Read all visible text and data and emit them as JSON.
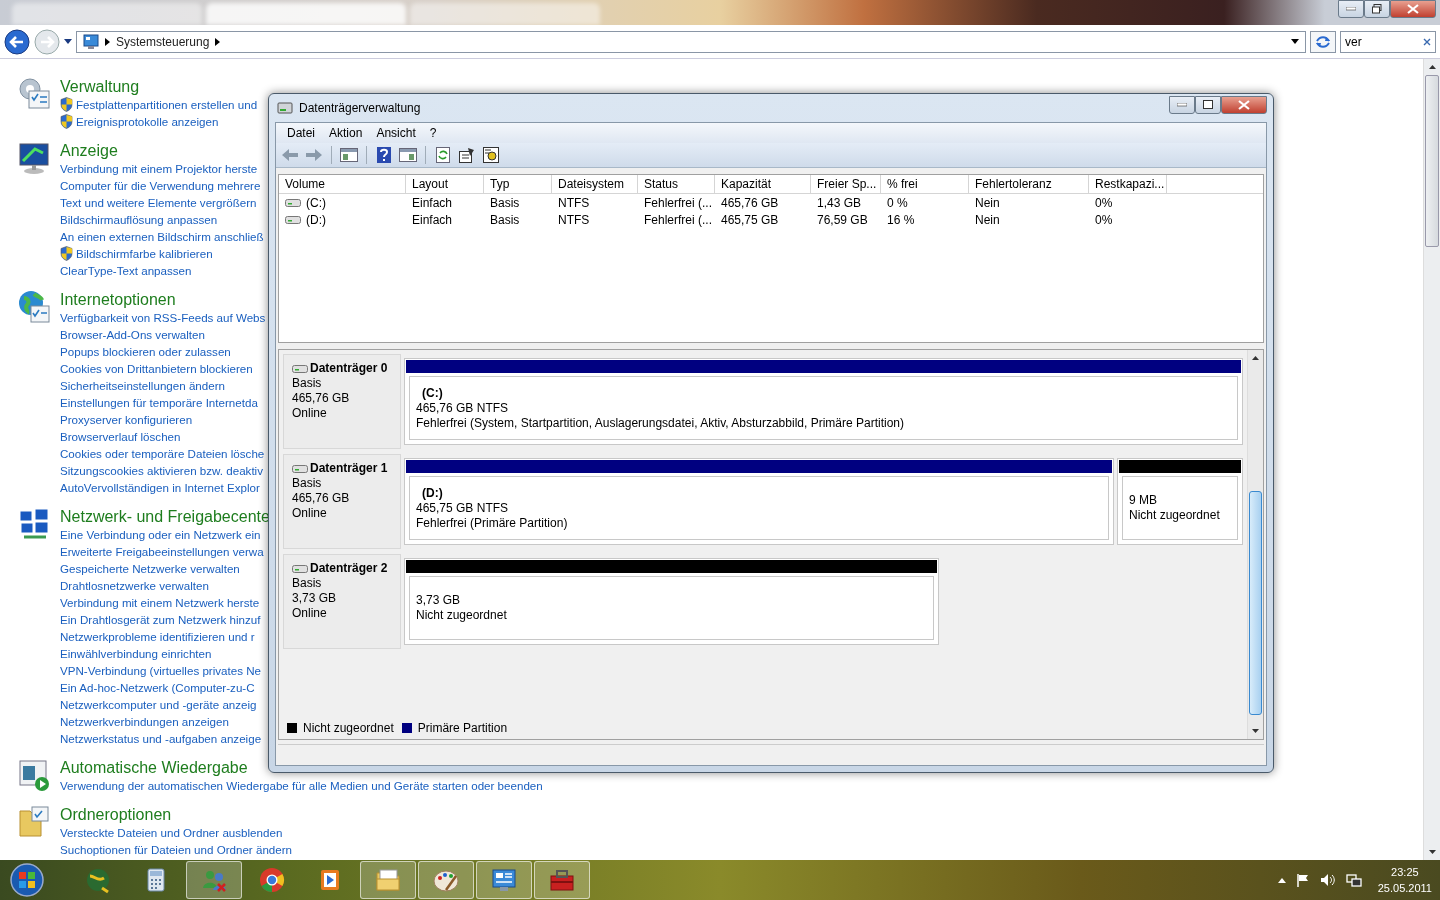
{
  "explorer": {
    "breadcrumb": [
      "Systemsteuerung"
    ],
    "search": {
      "value": "ver"
    }
  },
  "categories": [
    {
      "kind": "admin",
      "title": "Verwaltung",
      "links": [
        {
          "text": "Festplattenpartitionen erstellen und",
          "shield": true
        },
        {
          "text": "Ereignisprotokolle anzeigen",
          "shield": true
        }
      ]
    },
    {
      "kind": "display",
      "title": "Anzeige",
      "links": [
        {
          "text": "Verbindung mit einem Projektor herste",
          "shield": false
        },
        {
          "text": "Computer für die Verwendung mehrere",
          "shield": false
        },
        {
          "text": "Text und weitere Elemente vergrößern",
          "shield": false
        },
        {
          "text": "Bildschirmauflösung anpassen",
          "shield": false
        },
        {
          "text": "An einen externen Bildschirm anschließ",
          "shield": false
        },
        {
          "text": "Bildschirmfarbe kalibrieren",
          "shield": true
        },
        {
          "text": "ClearType-Text anpassen",
          "shield": false
        }
      ]
    },
    {
      "kind": "internet",
      "title": "Internetoptionen",
      "links": [
        {
          "text": "Verfügbarkeit von RSS-Feeds auf Webs",
          "shield": false
        },
        {
          "text": "Browser-Add-Ons verwalten",
          "shield": false
        },
        {
          "text": "Popups blockieren oder zulassen",
          "shield": false
        },
        {
          "text": "Cookies von Drittanbietern blockieren",
          "shield": false
        },
        {
          "text": "Sicherheitseinstellungen ändern",
          "shield": false
        },
        {
          "text": "Einstellungen für temporäre Internetda",
          "shield": false
        },
        {
          "text": "Proxyserver konfigurieren",
          "shield": false
        },
        {
          "text": "Browserverlauf löschen",
          "shield": false
        },
        {
          "text": "Cookies oder temporäre Dateien lösche",
          "shield": false
        },
        {
          "text": "Sitzungscookies aktivieren bzw. deaktiv",
          "shield": false
        },
        {
          "text": "AutoVervollständigen in Internet Explor",
          "shield": false
        }
      ]
    },
    {
      "kind": "network",
      "title": "Netzwerk- und Freigabecente",
      "links": [
        {
          "text": "Eine Verbindung oder ein Netzwerk ein",
          "shield": false
        },
        {
          "text": "Erweiterte Freigabeeinstellungen verwa",
          "shield": false
        },
        {
          "text": "Gespeicherte Netzwerke verwalten",
          "shield": false
        },
        {
          "text": "Drahtlosnetzwerke verwalten",
          "shield": false
        },
        {
          "text": "Verbindung mit einem Netzwerk herste",
          "shield": false
        },
        {
          "text": "Ein Drahtlosgerät zum Netzwerk hinzuf",
          "shield": false
        },
        {
          "text": "Netzwerkprobleme identifizieren und r",
          "shield": false
        },
        {
          "text": "Einwählverbindung einrichten",
          "shield": false
        },
        {
          "text": "VPN-Verbindung (virtuelles privates Ne",
          "shield": false
        },
        {
          "text": "Ein Ad-hoc-Netzwerk (Computer-zu-C",
          "shield": false
        },
        {
          "text": "Netzwerkcomputer und -geräte anzeig",
          "shield": false
        },
        {
          "text": "Netzwerkverbindungen anzeigen",
          "shield": false
        },
        {
          "text": "Netzwerkstatus und -aufgaben anzeige",
          "shield": false
        }
      ]
    },
    {
      "kind": "autoplay",
      "title": "Automatische Wiedergabe",
      "links": [
        {
          "text": "Verwendung der automatischen Wiedergabe für alle Medien und Geräte starten oder beenden",
          "shield": false
        }
      ]
    },
    {
      "kind": "folder",
      "title": "Ordneroptionen",
      "links": [
        {
          "text": "Versteckte Dateien und Ordner ausblenden",
          "shield": false
        },
        {
          "text": "Suchoptionen für Dateien und Ordner ändern",
          "shield": false
        }
      ]
    }
  ],
  "dialog": {
    "title": "Datenträgerverwaltung",
    "menu": [
      "Datei",
      "Aktion",
      "Ansicht",
      "?"
    ],
    "table": {
      "columns": [
        "Volume",
        "Layout",
        "Typ",
        "Dateisystem",
        "Status",
        "Kapazität",
        "Freier Sp...",
        "% frei",
        "Fehlertoleranz",
        "Restkapazi..."
      ],
      "rows": [
        [
          "(C:)",
          "Einfach",
          "Basis",
          "NTFS",
          "Fehlerfrei (...",
          "465,76 GB",
          "1,43 GB",
          "0 %",
          "Nein",
          "0%"
        ],
        [
          "(D:)",
          "Einfach",
          "Basis",
          "NTFS",
          "Fehlerfrei (...",
          "465,75 GB",
          "76,59 GB",
          "16 %",
          "Nein",
          "0%"
        ]
      ]
    },
    "disks": [
      {
        "name": "Datenträger 0",
        "type": "Basis",
        "size": "465,76 GB",
        "state": "Online",
        "partitions": [
          {
            "kind": "primary",
            "name": "(C:)",
            "size": "465,76 GB NTFS",
            "status": "Fehlerfrei (System, Startpartition, Auslagerungsdatei, Aktiv, Absturzabbild, Primäre Partition)"
          }
        ]
      },
      {
        "name": "Datenträger 1",
        "type": "Basis",
        "size": "465,76 GB",
        "state": "Online",
        "partitions": [
          {
            "kind": "primary",
            "name": "(D:)",
            "size": "465,75 GB NTFS",
            "status": "Fehlerfrei (Primäre Partition)"
          },
          {
            "kind": "unallocated",
            "size": "9 MB",
            "status": "Nicht zugeordnet"
          }
        ]
      },
      {
        "name": "Datenträger 2",
        "type": "Basis",
        "size": "3,73 GB",
        "state": "Online",
        "partitions": [
          {
            "kind": "unallocated",
            "size": "3,73 GB",
            "status": "Nicht zugeordnet"
          }
        ]
      }
    ],
    "legend": [
      {
        "kind": "unallocated",
        "label": "Nicht zugeordnet",
        "color": "#000000"
      },
      {
        "kind": "primary",
        "label": "Primäre Partition",
        "color": "#000080"
      }
    ]
  },
  "taskbar": {
    "apps": [
      {
        "kind": "globe",
        "running": false
      },
      {
        "kind": "calculator",
        "running": false
      },
      {
        "kind": "people",
        "running": true
      },
      {
        "kind": "chrome",
        "running": false
      },
      {
        "kind": "media",
        "running": false
      },
      {
        "kind": "folder",
        "running": true
      },
      {
        "kind": "paint",
        "running": true
      },
      {
        "kind": "panel",
        "running": true
      },
      {
        "kind": "toolbox",
        "running": true
      }
    ],
    "time": "23:25",
    "date": "25.05.2011"
  }
}
